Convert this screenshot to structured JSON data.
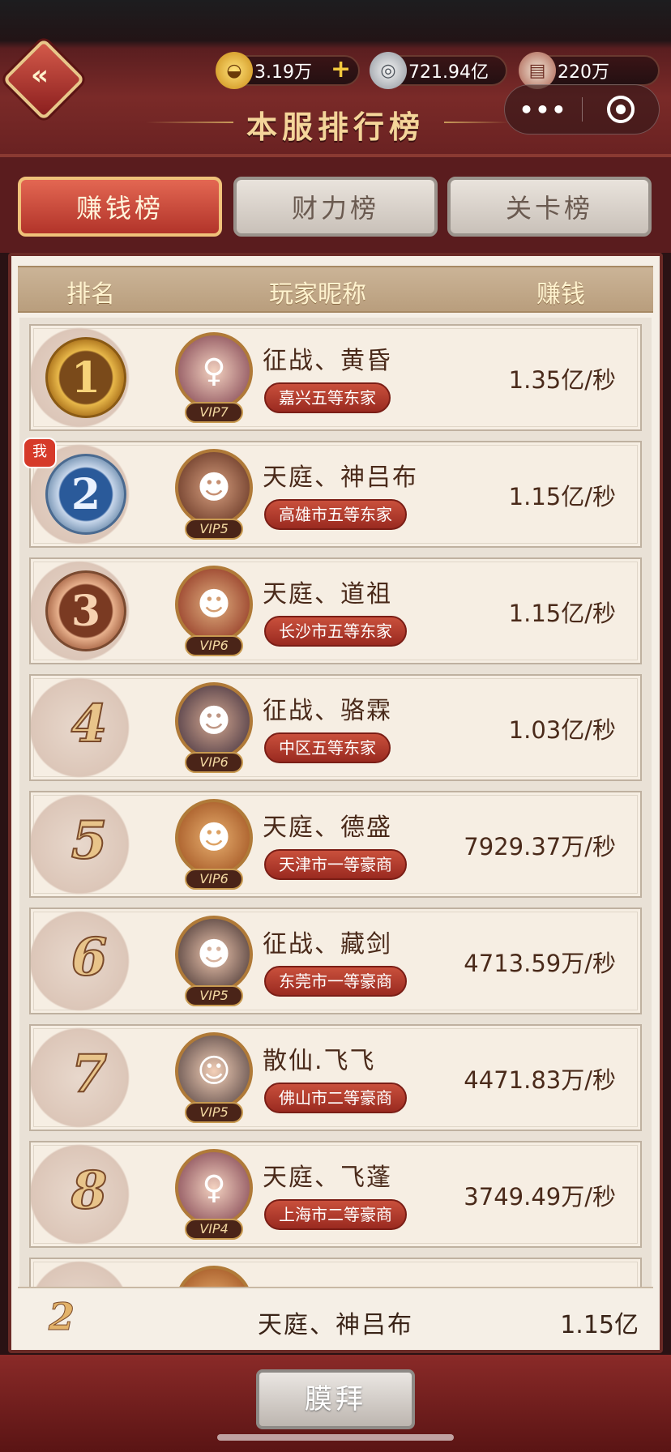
{
  "header": {
    "title": "本服排行榜",
    "gold": "3.19万",
    "silver": "721.94亿",
    "scroll": "220万"
  },
  "tabs": [
    "赚钱榜",
    "财力榜",
    "关卡榜"
  ],
  "columns": {
    "rank": "排名",
    "name": "玩家昵称",
    "earn": "赚钱"
  },
  "rows": [
    {
      "rank": "1",
      "name": "征战、黄昏",
      "vip": "VIP7",
      "title": "嘉兴五等东家",
      "earn": "1.35亿/秒"
    },
    {
      "rank": "2",
      "name": "天庭、神吕布",
      "vip": "VIP5",
      "title": "高雄市五等东家",
      "earn": "1.15亿/秒",
      "me": "我"
    },
    {
      "rank": "3",
      "name": "天庭、道祖",
      "vip": "VIP6",
      "title": "长沙市五等东家",
      "earn": "1.15亿/秒"
    },
    {
      "rank": "4",
      "name": "征战、骆霖",
      "vip": "VIP6",
      "title": "中区五等东家",
      "earn": "1.03亿/秒"
    },
    {
      "rank": "5",
      "name": "天庭、德盛",
      "vip": "VIP6",
      "title": "天津市一等豪商",
      "earn": "7929.37万/秒"
    },
    {
      "rank": "6",
      "name": "征战、藏剑",
      "vip": "VIP5",
      "title": "东莞市一等豪商",
      "earn": "4713.59万/秒"
    },
    {
      "rank": "7",
      "name": "散仙.飞飞",
      "vip": "VIP5",
      "title": "佛山市二等豪商",
      "earn": "4471.83万/秒"
    },
    {
      "rank": "8",
      "name": "天庭、飞蓬",
      "vip": "VIP4",
      "title": "上海市二等豪商",
      "earn": "3749.49万/秒"
    }
  ],
  "self": {
    "rank": "2",
    "name": "天庭、神吕布",
    "earn": "1.15亿"
  },
  "worship_button": "膜拜",
  "capsule": {
    "more": "•••"
  },
  "icons": [
    "back-icon",
    "gold-ingot-icon",
    "silver-coin-icon",
    "scroll-icon",
    "plus-icon",
    "more-icon",
    "target-icon"
  ],
  "colors": {
    "accent": "#c9503c",
    "gold": "#f4d59a",
    "panel": "#f5efe6"
  }
}
